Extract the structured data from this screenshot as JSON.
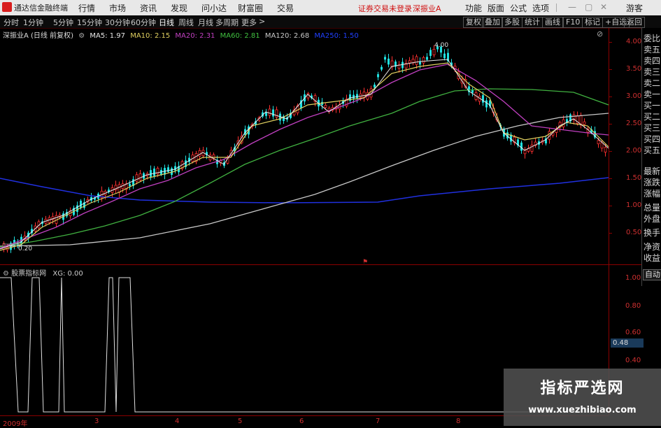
{
  "titlebar": {
    "app_name": "通达信金融终端",
    "menus": [
      "行情",
      "市场",
      "资讯",
      "发现",
      "问小达",
      "财富圈",
      "交易"
    ],
    "notice": "证券交易未登录",
    "stock_name": "深振业A",
    "right_menus": [
      "功能",
      "版面",
      "公式",
      "选项"
    ],
    "user": "游客"
  },
  "period_bar": {
    "periods": [
      "分时",
      "1分钟",
      "5分钟",
      "15分钟",
      "30分钟",
      "60分钟",
      "日线",
      "周线",
      "月线",
      "多周期",
      "更多"
    ],
    "active": "日线",
    "tools": [
      "复权",
      "叠加",
      "多股",
      "统计",
      "画线",
      "F10",
      "标记",
      "+自选",
      "返回"
    ]
  },
  "main_chart": {
    "title": "深振业A (日线 前复权)",
    "ma_legend": [
      {
        "label": "MA5: 1.97",
        "color": "#e8e8e8"
      },
      {
        "label": "MA10: 2.15",
        "color": "#e0d060"
      },
      {
        "label": "MA20: 2.31",
        "color": "#c040c0"
      },
      {
        "label": "MA60: 2.81",
        "color": "#40c040"
      },
      {
        "label": "MA120: 2.68",
        "color": "#c8c8c8"
      },
      {
        "label": "MA250: 1.50",
        "color": "#2040ff"
      }
    ],
    "y_ticks": [
      "4.00",
      "3.50",
      "3.00",
      "2.50",
      "2.00",
      "1.50",
      "1.00",
      "0.50"
    ],
    "high_label": "4.00",
    "low_label": "0.20"
  },
  "right_panel": {
    "items": [
      "委比",
      "卖五",
      "卖四",
      "卖三",
      "卖二",
      "卖一",
      "买一",
      "买二",
      "买三",
      "买四",
      "买五",
      "最新",
      "涨跌",
      "涨幅",
      "总量",
      "外盘",
      "换手",
      "净资",
      "收益"
    ],
    "auto_label": "自动"
  },
  "sub_chart": {
    "title": "股票指标网",
    "xg_label": "XG: 0.00",
    "y_ticks": [
      "1.00",
      "0.80",
      "0.60",
      "0.40"
    ],
    "current_value": "0.48"
  },
  "x_axis": {
    "labels": [
      "2009年",
      "3",
      "4",
      "5",
      "6",
      "7",
      "8"
    ]
  },
  "watermark": {
    "title": "指标严选网",
    "url": "www.xuezhibiao.com"
  },
  "colors": {
    "up": "#ff3030",
    "down": "#20e0e0",
    "axis": "#8b0000",
    "tick_text": "#d03030"
  }
}
